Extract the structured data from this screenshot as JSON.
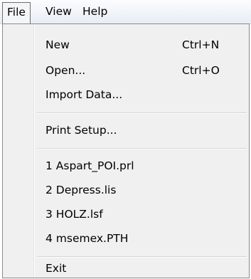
{
  "menubar": {
    "file": "File",
    "view": "View",
    "help": "Help"
  },
  "file_menu": {
    "new": {
      "label": "New",
      "shortcut": "Ctrl+N"
    },
    "open": {
      "label": "Open...",
      "shortcut": "Ctrl+O"
    },
    "import_data": "Import Data...",
    "print_setup": "Print Setup...",
    "recent_files": [
      "1 Aspart_POI.prl",
      "2 Depress.lis",
      "3 HOLZ.lsf",
      "4 msemex.PTH"
    ],
    "exit": "Exit"
  }
}
